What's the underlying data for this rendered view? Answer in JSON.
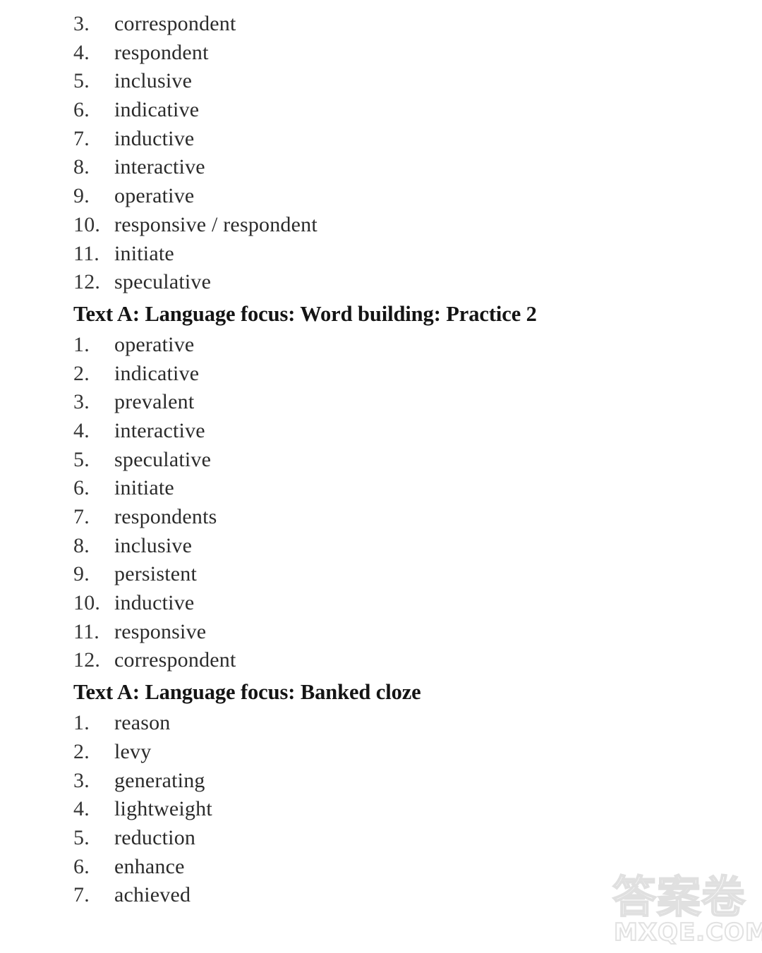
{
  "document": {
    "background_color": "#ffffff",
    "text_color": "#2b2b2b",
    "heading_color": "#141414"
  },
  "blocks": [
    {
      "type": "list",
      "name": "word-building-practice-1-answers",
      "items": [
        {
          "number": "3.",
          "text": "correspondent"
        },
        {
          "number": "4.",
          "text": "respondent"
        },
        {
          "number": "5.",
          "text": "inclusive"
        },
        {
          "number": "6.",
          "text": "indicative"
        },
        {
          "number": "7.",
          "text": "inductive"
        },
        {
          "number": "8.",
          "text": "interactive"
        },
        {
          "number": "9.",
          "text": "operative"
        },
        {
          "number": "10.",
          "text": "responsive / respondent"
        },
        {
          "number": "11.",
          "text": "initiate"
        },
        {
          "number": "12.",
          "text": "speculative"
        }
      ]
    },
    {
      "type": "heading",
      "name": "heading-word-building-practice-2",
      "text": "Text A: Language focus: Word building: Practice 2"
    },
    {
      "type": "list",
      "name": "word-building-practice-2-answers",
      "items": [
        {
          "number": "1.",
          "text": "operative"
        },
        {
          "number": "2.",
          "text": "indicative"
        },
        {
          "number": "3.",
          "text": "prevalent"
        },
        {
          "number": "4.",
          "text": "interactive"
        },
        {
          "number": "5.",
          "text": "speculative"
        },
        {
          "number": "6.",
          "text": "initiate"
        },
        {
          "number": "7.",
          "text": "respondents"
        },
        {
          "number": "8.",
          "text": "inclusive"
        },
        {
          "number": "9.",
          "text": "persistent"
        },
        {
          "number": "10.",
          "text": "inductive"
        },
        {
          "number": "11.",
          "text": "responsive"
        },
        {
          "number": "12.",
          "text": "correspondent"
        }
      ]
    },
    {
      "type": "heading",
      "name": "heading-banked-cloze",
      "text": "Text A: Language focus: Banked cloze"
    },
    {
      "type": "list",
      "name": "banked-cloze-answers",
      "items": [
        {
          "number": "1.",
          "text": "reason"
        },
        {
          "number": "2.",
          "text": "levy"
        },
        {
          "number": "3.",
          "text": "generating"
        },
        {
          "number": "4.",
          "text": "lightweight"
        },
        {
          "number": "5.",
          "text": "reduction"
        },
        {
          "number": "6.",
          "text": "enhance"
        },
        {
          "number": "7.",
          "text": "achieved"
        }
      ]
    }
  ],
  "watermark": {
    "cjk_text": "答案卷",
    "domain_text": "MXQE.COM",
    "color": "#e0e0e0"
  }
}
